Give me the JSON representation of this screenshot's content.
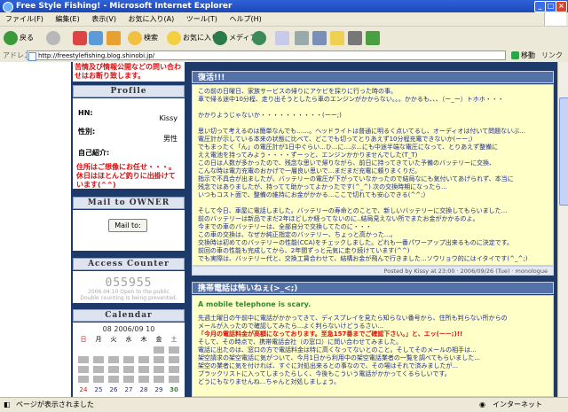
{
  "window": {
    "title": "Free Style Fishing! - Microsoft Internet Explorer",
    "min": "_",
    "max": "□",
    "close": "×"
  },
  "menu": [
    "ファイル(F)",
    "編集(E)",
    "表示(V)",
    "お気に入り(A)",
    "ツール(T)",
    "ヘルプ(H)"
  ],
  "toolbar": {
    "back": "戻る",
    "search": "検索",
    "favorites": "お気に入り",
    "media": "メディア"
  },
  "address": {
    "label": "アドレス(D)",
    "url": "http://freestylefishing.blog.shinobi.jp/",
    "go": "移動",
    "links": "リンク"
  },
  "sidebar": {
    "notice": "苦情及び情報公開などの問い合わせはお断り致します。",
    "profile": {
      "heading": "Profile",
      "hn_label": "HN:",
      "hn_value": "Kissy",
      "gender_label": "性別:",
      "gender_value": "男性",
      "intro_label": "自己紹介:",
      "intro_text": "住所はご想像にお任せ・・・。休日はほとんど釣りに出掛けています(^^)"
    },
    "mail": {
      "heading": "Mail to OWNER",
      "button": "Mail to:"
    },
    "access": {
      "heading": "Access Counter",
      "digits": "055955",
      "note1": "2006.04.10 Open to the public",
      "note2": "Double counting is being prevented."
    },
    "calendar": {
      "heading": "Calendar",
      "title": "08  2006/09  10",
      "weekdays": [
        "日",
        "月",
        "火",
        "水",
        "木",
        "金",
        "土"
      ],
      "last_row": [
        "24",
        "25",
        "26",
        "27",
        "28",
        "29",
        "30"
      ]
    }
  },
  "entries": [
    {
      "title": "復活!!!",
      "lines": [
        "この前の日曜日、家族サービスの帰りにアケビを採りに行った時の事。",
        "車で帰る途中10分程、走り出そうとしたら車のエンジンがかからない。。。かかるも、、、（ー_ー）トホホ・・・",
        "",
        "かかりようじゃないか・・・・・・・・・・(ーー;)",
        "",
        "思い切って考えるのは簡単なんでも……。ヘッドライトは普通に明るく点いてるし、オーディオは付いて問題ないぶ...",
        "電圧計が示している本来の状態に比べて、どこでも切ってとりあえず10分程充電できないか(ーー;)",
        "でもまったく「ん」の電圧計が1日中ぐらい...ひ...に...ぶ...にも中途半端な電圧になって、とりあえず整備に",
        "ええ電池を持ってみよう・・・・ずーっと、エンジンかかりませんでした(T_T)",
        "この日は人数が多かったので、残念な思いで帰りながら、前日に持ってきていた予備のバッテリーに交換、",
        "こんな時は電力充電のおかげで一層良い思いで...まだまだ充電に頼りまくりだ。",
        "指示で不具合が出ましたが、バッテリーの電圧が下がっていなかったので結局なにも気付いてあげられず、本当に",
        "残念ではありましたが、持ってて助かってよかったです(^_^)  次の交換時期になったら...",
        "いつもコスト面で、整備の維持にお金がかかる...ここで切れても安心できる(^^;)",
        "",
        "そして今日、車屋に電話しました。バッテリーの寿命とのことで、新しいバッテリーに交換してもらいました...",
        "前のバッテリーは新品でまだ2年ほどしか経ってないのに..結局見えない所でまたお金がかかるのよ。",
        "今までの車のバッテリーは、全部自分で交換してたのに・・・",
        "この車の交換は、なぜか純正指定のバッテリー、ちょっと高かった...。",
        "交換時は初めてのバッテリーの性能(CCA)をチェックしました。どれも一番パワーアップ出来るものに決定です。",
        "前回の車の性能も完成してから、2年間ずっと元気に走り続けています(^^)",
        "でも実際は、バッテリー代と、交換工賃合わせて、結構お金が飛んで行きました...ソウリョウ的にはイタイです(^_^;)"
      ],
      "footer": "Posted by Kissy at 23:00 · 2006/09/26 (Tue) · monologue"
    },
    {
      "title": "携帯電話は怖いねぇ(>_<;)",
      "subtitle": "A mobile telephone is scary.",
      "lines": [
        "先週土曜日の午前中に電話がかかってきて、ディスプレイを見たら知らない番号から、住所も判らない所からの",
        "メールが入ったので確認してみたら...よく判らないけどうるさい...",
        "「今月の電話料金が高額になっております。至急157番までご確認下さい。」と、エッ(ーー;)!!",
        "そして、その時点で、携帯電話会社（の窓口）に問い合わせてみました。",
        "電話に出たのは、窓口の方で電話料金は特に高くなってないとのこと。そしてそのメールの相手は...",
        "架空請求の架空電話に気がついて、今月1日から利用中の架空電話業者の一覧を調べてもらいました...",
        "架空の業者に気を付ければ、すぐに対処出来るとの事なので、その場はそれで済みましたが...",
        "ブラックリストに入ってしまったらしく、今後もこういう電話がかかってくるらしいです。",
        "どうにもなりませんね...ちゃんと対処しましょう。"
      ]
    }
  ],
  "status": {
    "left": "ページが表示されました",
    "right": "インターネット"
  },
  "colors": {
    "titlebar": "#1c47b8",
    "page_bg": "#1d3a6b",
    "entry_bg": "#ffffc8",
    "entry_head": "#5572a8",
    "notice_red": "#d81010"
  }
}
